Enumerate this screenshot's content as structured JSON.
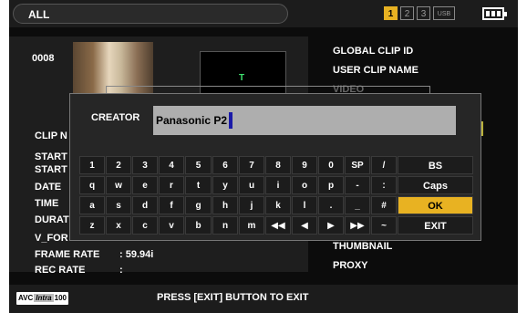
{
  "topbar": {
    "mode_label": "ALL",
    "slots": [
      "1",
      "2",
      "3",
      "USB"
    ],
    "selected_slot": "1",
    "accent_color": "#e8b222"
  },
  "clip": {
    "number": "0008",
    "preview_marker": "T"
  },
  "details": [
    {
      "label": "CLIP N",
      "value": ""
    },
    {
      "label": "START",
      "value": ""
    },
    {
      "label": "START",
      "value": ""
    },
    {
      "label": "DATE",
      "value": ""
    },
    {
      "label": "TIME",
      "value": ""
    },
    {
      "label": "DURAT",
      "value": ""
    },
    {
      "label": "V_FOR",
      "value": ""
    },
    {
      "label": "FRAME RATE",
      "value": ": 59.94i"
    },
    {
      "label": "REC RATE",
      "value": ":"
    }
  ],
  "right_menu": [
    {
      "label": "GLOBAL CLIP ID"
    },
    {
      "label": "USER CLIP NAME"
    },
    {
      "label": "VIDEO"
    },
    {
      "label": "THUMBNAIL"
    },
    {
      "label": "PROXY"
    }
  ],
  "dialog": {
    "label": "CREATOR",
    "value": "Panasonic P2"
  },
  "keyboard": [
    [
      "1",
      "2",
      "3",
      "4",
      "5",
      "6",
      "7",
      "8",
      "9",
      "0",
      "SP",
      "/",
      "BS"
    ],
    [
      "q",
      "w",
      "e",
      "r",
      "t",
      "y",
      "u",
      "i",
      "o",
      "p",
      "-",
      ":",
      "Caps"
    ],
    [
      "a",
      "s",
      "d",
      "f",
      "g",
      "h",
      "j",
      "k",
      "l",
      ".",
      "_",
      "#",
      "OK"
    ],
    [
      "z",
      "x",
      "c",
      "v",
      "b",
      "n",
      "m",
      "◀◀",
      "◀",
      "▶",
      "▶▶",
      "~",
      "EXIT"
    ]
  ],
  "keyboard_selected": "OK",
  "bottombar": {
    "codec_badge": [
      "AVC",
      "Intra",
      "100"
    ],
    "status": "PRESS [EXIT] BUTTON TO EXIT"
  }
}
